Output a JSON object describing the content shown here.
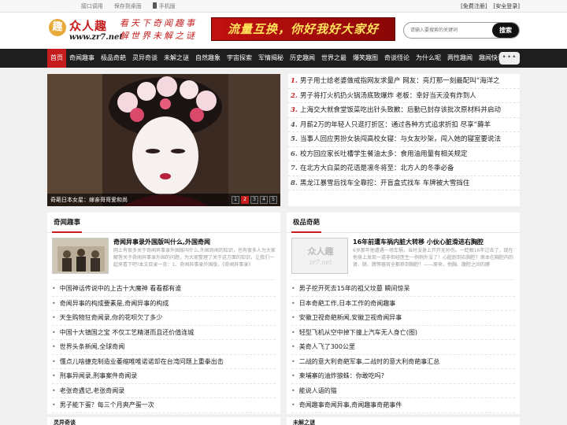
{
  "topbar": {
    "dots": "· · ·",
    "links": [
      "接口调用",
      "保存到桌面",
      "手机版"
    ],
    "right": [
      "[免费注册]",
      "[安全登录]"
    ]
  },
  "brand": {
    "badge": "趣",
    "name": "众人趣",
    "url": "www.zr7.net",
    "slogan_line1": "看天下奇闻趣事",
    "slogan_line2": "解世界未解之谜"
  },
  "banner": {
    "text": "流量互换，你好我好大家好"
  },
  "search": {
    "placeholder": "请输入要搜索的关键词",
    "button": "搜索"
  },
  "nav": {
    "items": [
      "首页",
      "奇闻趣事",
      "极品奇葩",
      "灵异奇谈",
      "未解之谜",
      "自然趣象",
      "宇宙探索",
      "军情揭秘",
      "历史趣闻",
      "世界之最",
      "爆笑趣图",
      "奇谈怪论",
      "为什么呢",
      "两性趣闻",
      "趣闻快讯"
    ],
    "more": "•••"
  },
  "hero": {
    "caption": "奇葩日本女星：嫁亲哥哥爱和尚",
    "pages": [
      "1",
      "2",
      "3",
      "4",
      "5"
    ],
    "active_page": 2
  },
  "toplist": [
    {
      "n": "1.",
      "t": "男子用士给老婆做戒指网友求量产 网友：亮灯那一刻最配叫“海洋之"
    },
    {
      "n": "2.",
      "t": "男子将打火机扔火锅汤底致爆炸 老板：幸好当天没有炸到人"
    },
    {
      "n": "3.",
      "t": "上海交大就食堂饭菜吃出针头致歉：后勤已封存该批次原材料并启动"
    },
    {
      "n": "4.",
      "t": "月薪2万的年轻人只逛打折区：通过各种方式追求折扣 尽享“薅羊"
    },
    {
      "n": "5.",
      "t": "当事人回应男扮女装闯高校女寝：与女友吵架，闯入她的寝室要说法"
    },
    {
      "n": "6.",
      "t": "校方回应家长吐槽学生餐油太多：食用油用量有相关规定"
    },
    {
      "n": "7.",
      "t": "在北方大白菜的花语是凛冬将至：北方人的冬季必备"
    },
    {
      "n": "8.",
      "t": "黑龙江暴雪后找车全靠挖：开盲盒式找车 车牌被大雪挡住"
    }
  ],
  "panel_left": {
    "title": "奇闻趣事",
    "feature_title": "奇闻异事录外国版叫什么,外国奇闻",
    "feature_desc": "网上有很多关于奇闻异事录外国版叫什么,外国奇闻的知识，也有很多人为大家解答关于奇闻异事录外国的问题，为大家整理了关于这方面的知识，让我们一起来看下吧!本文目录一览：1、奇闻异事录外国版，《奇闻异事录》",
    "items": [
      "中国神话传说中的上古十大魔神 看看都有谁",
      "奇闻异事的构成要素是,奇闻异事的构成",
      "天生购物狂奇闻录,你的花呗欠了多少",
      "中国十大镇国之宝 不仅工艺精湛而且还价值连城",
      "世界头条新闻,全球奇闻",
      "懂点儿啥捷克制造业萎缩唯唯诺诺却在台湾问题上重拳出击",
      "刑事异闻录,刑事案件奇闻录",
      "老张奇遇记,老张奇闻录",
      "男子能下蛋？每三个月爽产蛋一次"
    ]
  },
  "panel_right": {
    "title": "极品奇葩",
    "thumb_brand": "众人趣",
    "thumb_url": "zr7.net",
    "feature_title": "16年前遭车祸内脏大转移 小伙心脏滑进右胸腔",
    "feature_desc": "6岁那年他遭遇一场车祸，当时没身上开开无孙伤。一眨眼16年过去了，现在他身上发现一道非但经医生一例例外没了！心脏跑到右胸腔！原本在胸腔内的肾、肠、脾等器官全都移到胸腔！——原来，他胸、腹腔之间的膜",
    "items": [
      "男子挖开死去15年的祖父坟墓 瞬间惊呆",
      "日本奇葩工作,日本工作的奇闻趣事",
      "安徽卫视奇葩新闻,安徽卫视奇闻异事",
      "轻型飞机从空中掉下撞上汽车无人身亡(图)",
      "美奇人飞了300公里",
      "二战的意大利奇葩军事,二战时的意大利奇葩事汇总",
      "柬埔寨的油炸狼蛛：你敢吃吗?",
      "能说人语的猫",
      "奇闻趣事奇闻异事,奇闻趣事奇葩事件"
    ]
  },
  "bottom": {
    "left_title": "灵异奇谈",
    "right_title": "未解之谜"
  },
  "colors": {
    "accent": "#c51d1d",
    "nav_bg": "#1e1e1e"
  }
}
